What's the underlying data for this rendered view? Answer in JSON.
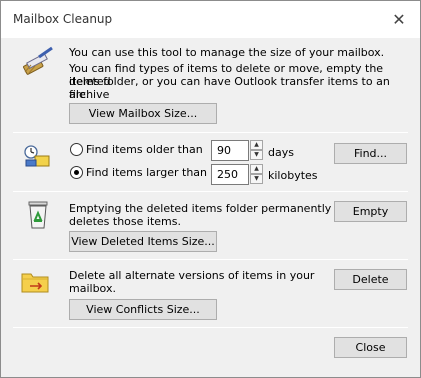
{
  "window": {
    "title": "Mailbox Cleanup",
    "close_glyph": "✕"
  },
  "section1": {
    "icon": "broom-icon",
    "intro": "You can use this tool to manage the size of your mailbox.",
    "line1": "You can find types of items to delete or move, empty the deleted",
    "line2": "items folder, or you can have Outlook transfer items to an archive",
    "line3": "file.",
    "view_size_label": "View Mailbox Size..."
  },
  "section2": {
    "icon": "find-items-icon",
    "older_label": "Find items older than",
    "older_value": "90",
    "older_unit": "days",
    "older_checked": false,
    "larger_label": "Find items larger than",
    "larger_value": "250",
    "larger_unit": "kilobytes",
    "larger_checked": true,
    "find_label": "Find..."
  },
  "section3": {
    "icon": "recycle-bin-icon",
    "line1": "Emptying the deleted items folder permanently",
    "line2": "deletes those items.",
    "empty_label": "Empty",
    "view_deleted_label": "View Deleted Items Size..."
  },
  "section4": {
    "icon": "conflicts-folder-icon",
    "line1": "Delete all alternate versions of items in your",
    "line2": "mailbox.",
    "delete_label": "Delete",
    "view_conflicts_label": "View Conflicts Size..."
  },
  "footer": {
    "close_label": "Close"
  }
}
